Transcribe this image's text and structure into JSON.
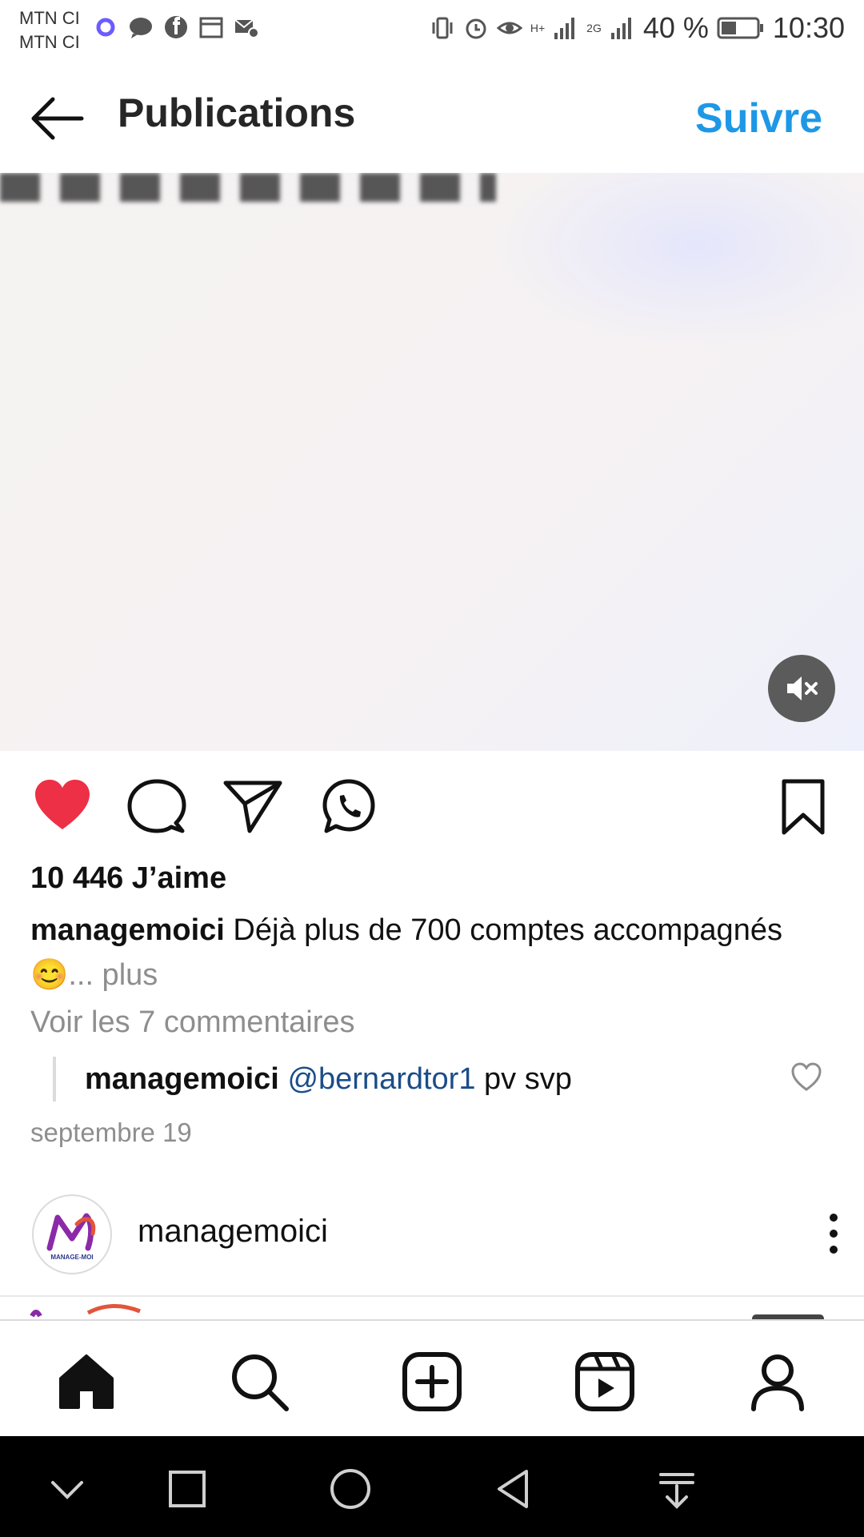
{
  "status_bar": {
    "carrier_1": "MTN CI",
    "carrier_2": "MTN CI",
    "network_1": "H+",
    "network_2": "2G",
    "battery": "40 %",
    "time": "10:30"
  },
  "header": {
    "title": "Publications",
    "follow_label": "Suivre"
  },
  "post": {
    "likes": "10 446 J’aime",
    "caption_user": "managemoici",
    "caption_text": " Déjà plus de 700 comptes accompagnés😊",
    "caption_more": "... plus",
    "view_comments": "Voir les 7 commentaires",
    "reply": {
      "user": "managemoici",
      "mention": "@bernardtor1",
      "text": " pv svp"
    },
    "date": "septembre 19"
  },
  "next_post": {
    "username": "managemoici",
    "avatar_text": "MANAGE-MOI"
  },
  "colors": {
    "accent": "#1e98e6",
    "like_red": "#ed3046",
    "mention": "#1b4d89"
  },
  "icons": {
    "actions": [
      "heart-icon",
      "comment-icon",
      "share-icon",
      "whatsapp-icon",
      "bookmark-icon"
    ],
    "bottom_nav": [
      "home-icon",
      "search-icon",
      "add-icon",
      "reels-icon",
      "profile-icon"
    ],
    "system_nav": [
      "chevron-down-icon",
      "recents-icon",
      "home-circle-icon",
      "back-triangle-icon",
      "notification-pull-icon"
    ]
  }
}
